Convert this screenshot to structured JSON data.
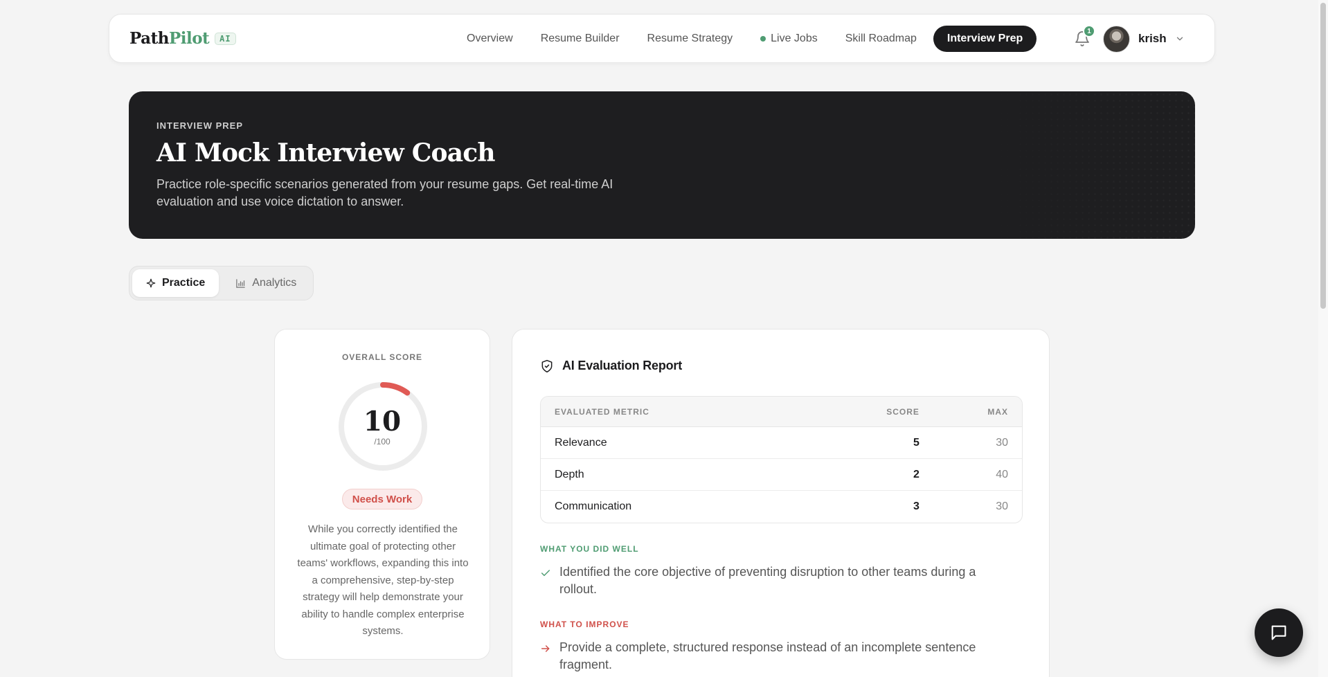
{
  "brand": {
    "name_part1": "Path",
    "name_part2": "Pilot",
    "badge": "AI"
  },
  "nav": {
    "links": [
      {
        "label": "Overview"
      },
      {
        "label": "Resume Builder"
      },
      {
        "label": "Resume Strategy"
      },
      {
        "label": "Live Jobs",
        "live_dot": true
      },
      {
        "label": "Skill Roadmap"
      },
      {
        "label": "Interview Prep",
        "active": true
      }
    ],
    "notifications_count": "1",
    "user_name": "krish"
  },
  "hero": {
    "eyebrow": "INTERVIEW PREP",
    "title": "AI Mock Interview Coach",
    "description": "Practice role-specific scenarios generated from your resume gaps. Get real-time AI evaluation and use voice dictation to answer."
  },
  "tabs": [
    {
      "label": "Practice",
      "icon": "sparkle-icon",
      "active": true
    },
    {
      "label": "Analytics",
      "icon": "bar-chart-icon",
      "active": false
    }
  ],
  "score": {
    "label": "OVERALL SCORE",
    "value": "10",
    "max": "/100",
    "progress": 0.1,
    "status": "Needs Work",
    "summary": "While you correctly identified the ultimate goal of protecting other teams' workflows, expanding this into a comprehensive, step-by-step strategy will help demonstrate your ability to handle complex enterprise systems."
  },
  "evaluation": {
    "title": "AI Evaluation Report",
    "columns": {
      "metric": "EVALUATED METRIC",
      "score": "SCORE",
      "max": "MAX"
    },
    "rows": [
      {
        "metric": "Relevance",
        "score": "5",
        "max": "30"
      },
      {
        "metric": "Depth",
        "score": "2",
        "max": "40"
      },
      {
        "metric": "Communication",
        "score": "3",
        "max": "30"
      }
    ],
    "did_well_label": "WHAT YOU DID WELL",
    "did_well": "Identified the core objective of preventing disruption to other teams during a rollout.",
    "improve_label": "WHAT TO IMPROVE",
    "improve": "Provide a complete, structured response instead of an incomplete sentence fragment."
  },
  "colors": {
    "accent_green": "#4f9c72",
    "accent_red": "#d0504a",
    "dark": "#1c1c1e",
    "ring_track": "#ececec",
    "ring_progress": "#e05a55"
  }
}
